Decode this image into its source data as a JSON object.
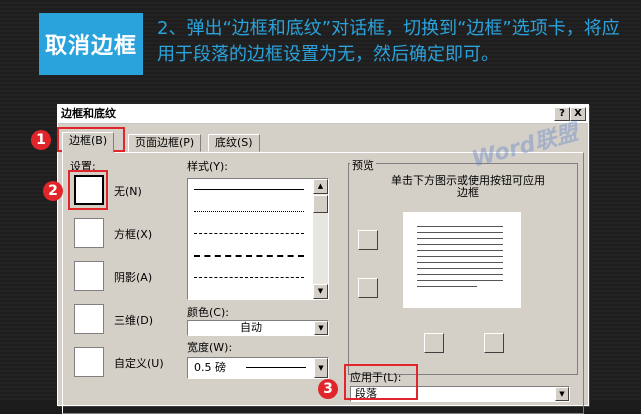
{
  "banner": {
    "title": "取消边框",
    "description": "2、弹出“边框和底纹”对话框，切换到“边框”选项卡，将应用于段落的边框设置为无，然后确定即可。"
  },
  "dialog": {
    "title": "边框和底纹",
    "help": "?",
    "close": "X",
    "tabs": [
      {
        "label": "边框(B)"
      },
      {
        "label": "页面边框(P)"
      },
      {
        "label": "底纹(S)"
      }
    ],
    "settings_label": "设置:",
    "settings": [
      {
        "label": "无(N)"
      },
      {
        "label": "方框(X)"
      },
      {
        "label": "阴影(A)"
      },
      {
        "label": "三维(D)"
      },
      {
        "label": "自定义(U)"
      }
    ],
    "style_label": "样式(Y):",
    "color_label": "颜色(C):",
    "color_value": "自动",
    "width_label": "宽度(W):",
    "width_value": "0.5 磅",
    "preview_label": "预览",
    "preview_hint": "单击下方图示或使用按钮可应用边框",
    "apply_label": "应用于(L):",
    "apply_value": "段落"
  },
  "annotations": [
    {
      "num": "1"
    },
    {
      "num": "2"
    },
    {
      "num": "3"
    }
  ],
  "watermark": "Word联盟",
  "colors": {
    "accent": "#2aa3dd",
    "highlight": "#e0262b",
    "dialog": "#d4d0c8"
  }
}
